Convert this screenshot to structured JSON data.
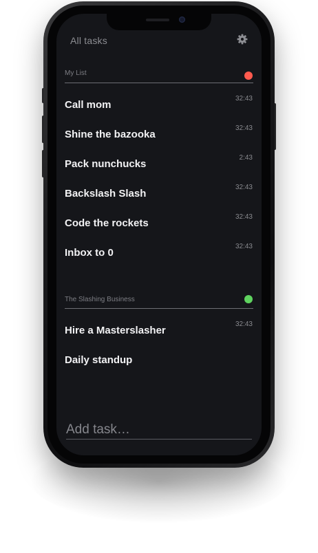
{
  "header": {
    "title": "All tasks",
    "settings_icon": "gear-icon"
  },
  "sections": [
    {
      "title": "My List",
      "dot_color": "#ff5a4e",
      "tasks": [
        {
          "label": "Call mom",
          "time": "32:43"
        },
        {
          "label": "Shine the bazooka",
          "time": "32:43"
        },
        {
          "label": "Pack nunchucks",
          "time": "2:43"
        },
        {
          "label": "Backslash Slash",
          "time": "32:43"
        },
        {
          "label": "Code the rockets",
          "time": "32:43"
        },
        {
          "label": "Inbox to 0",
          "time": "32:43"
        }
      ]
    },
    {
      "title": "The Slashing Business",
      "dot_color": "#5fd35f",
      "tasks": [
        {
          "label": "Hire a Masterslasher",
          "time": "32:43"
        },
        {
          "label": "Daily standup",
          "time": ""
        }
      ]
    }
  ],
  "add_task": {
    "placeholder": "Add task…",
    "value": ""
  },
  "colors": {
    "screen_background": "#15161a",
    "text_primary": "#f2f2f4",
    "text_muted": "#8c8d92"
  }
}
